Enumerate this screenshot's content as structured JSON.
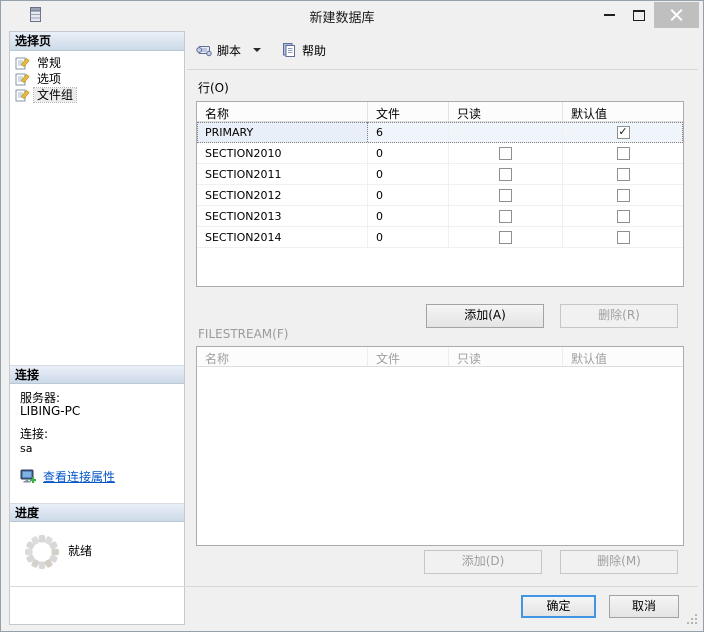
{
  "window": {
    "title": "新建数据库",
    "icon": "database-icon"
  },
  "sidebar": {
    "select_page": {
      "header": "选择页",
      "items": [
        {
          "label": "常规",
          "selected": false
        },
        {
          "label": "选项",
          "selected": false
        },
        {
          "label": "文件组",
          "selected": true
        }
      ]
    },
    "connection": {
      "header": "连接",
      "server_label": "服务器:",
      "server_value": "LIBING-PC",
      "conn_label": "连接:",
      "conn_value": "sa",
      "view_props_link": "查看连接属性"
    },
    "progress": {
      "header": "进度",
      "status": "就绪"
    }
  },
  "toolbar": {
    "script": "脚本",
    "help": "帮助"
  },
  "rows_section": {
    "label": "行(O)",
    "columns": [
      "名称",
      "文件",
      "只读",
      "默认值"
    ],
    "rows": [
      {
        "name": "PRIMARY",
        "files": "6",
        "readonly": "none",
        "default": "checked",
        "selected": true
      },
      {
        "name": "SECTION2010",
        "files": "0",
        "readonly": "unchecked",
        "default": "unchecked",
        "selected": false
      },
      {
        "name": "SECTION2011",
        "files": "0",
        "readonly": "unchecked",
        "default": "unchecked",
        "selected": false
      },
      {
        "name": "SECTION2012",
        "files": "0",
        "readonly": "unchecked",
        "default": "unchecked",
        "selected": false
      },
      {
        "name": "SECTION2013",
        "files": "0",
        "readonly": "unchecked",
        "default": "unchecked",
        "selected": false
      },
      {
        "name": "SECTION2014",
        "files": "0",
        "readonly": "unchecked",
        "default": "unchecked",
        "selected": false
      }
    ],
    "add_button": "添加(A)",
    "delete_button": "删除(R)"
  },
  "filestream_section": {
    "label": "FILESTREAM(F)",
    "columns": [
      "名称",
      "文件",
      "只读",
      "默认值"
    ],
    "rows": [],
    "add_button": "添加(D)",
    "delete_button": "删除(M)"
  },
  "footer": {
    "ok": "确定",
    "cancel": "取消"
  },
  "colors": {
    "accent_link": "#0556c9",
    "focus_border": "#4295e2",
    "section_header_top": "#eaf0f8",
    "section_header_bottom": "#ccd9e8",
    "close_button_bg": "#bfbfbf"
  }
}
